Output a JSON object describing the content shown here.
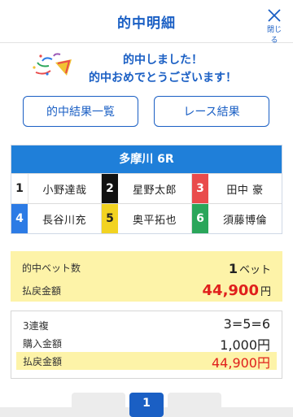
{
  "header": {
    "title": "的中明細",
    "close_label": "閉じる"
  },
  "congrats": {
    "line1": "的中しました！",
    "line2": "的中おめでとうございます！"
  },
  "buttons": {
    "results": "的中結果一覧",
    "race_results": "レース結果"
  },
  "race": {
    "title": "多摩川 6R",
    "racers": [
      {
        "lane": "1",
        "name": "小野達哉"
      },
      {
        "lane": "2",
        "name": "星野太郎"
      },
      {
        "lane": "3",
        "name": "田中 豪"
      },
      {
        "lane": "4",
        "name": "長谷川充"
      },
      {
        "lane": "5",
        "name": "奥平拓也"
      },
      {
        "lane": "6",
        "name": "須藤博倫"
      }
    ]
  },
  "summary": {
    "bet_count_label": "的中ベット数",
    "bet_count": "1",
    "bet_unit": "ベット",
    "payout_label": "払戻金額",
    "payout": "44,900",
    "payout_unit": "円"
  },
  "ticket": {
    "type": "3連複",
    "combination": "3=5=6",
    "purchase_label": "購入金額",
    "purchase_amount": "1,000円",
    "payout_label": "払戻金額",
    "payout_amount": "44,900円"
  },
  "pagination": {
    "current": "1"
  },
  "colors": {
    "accent": "#1a5fc4",
    "race_header": "#1f7fd9",
    "highlight": "#fdf3a8",
    "payout_red": "#e0201c"
  }
}
